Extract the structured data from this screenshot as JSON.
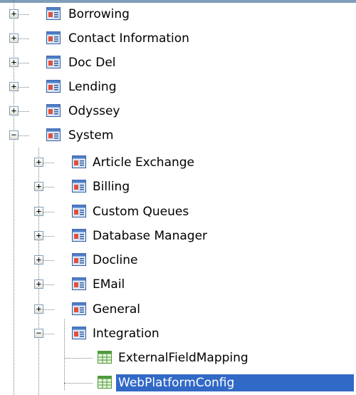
{
  "tree": {
    "nodes": [
      {
        "label": "Borrowing",
        "expander": "+",
        "icon": "report-form-icon"
      },
      {
        "label": "Contact Information",
        "expander": "+",
        "icon": "report-form-icon"
      },
      {
        "label": "Doc Del",
        "expander": "+",
        "icon": "report-form-icon"
      },
      {
        "label": "Lending",
        "expander": "+",
        "icon": "report-form-icon"
      },
      {
        "label": "Odyssey",
        "expander": "+",
        "icon": "report-form-icon"
      },
      {
        "label": "System",
        "expander": "−",
        "icon": "report-form-icon"
      },
      {
        "label": "Article Exchange",
        "expander": "+",
        "icon": "report-form-icon"
      },
      {
        "label": "Billing",
        "expander": "+",
        "icon": "report-form-icon"
      },
      {
        "label": "Custom Queues",
        "expander": "+",
        "icon": "report-form-icon"
      },
      {
        "label": "Database Manager",
        "expander": "+",
        "icon": "report-form-icon"
      },
      {
        "label": "Docline",
        "expander": "+",
        "icon": "report-form-icon"
      },
      {
        "label": "EMail",
        "expander": "+",
        "icon": "report-form-icon"
      },
      {
        "label": "General",
        "expander": "+",
        "icon": "report-form-icon"
      },
      {
        "label": "Integration",
        "expander": "−",
        "icon": "report-form-icon"
      },
      {
        "label": "ExternalFieldMapping",
        "expander": "",
        "icon": "table-grid-icon"
      },
      {
        "label": "WebPlatformConfig",
        "expander": "",
        "icon": "table-grid-icon",
        "selected": true
      }
    ]
  },
  "colors": {
    "selection": "#3169c6",
    "tree_lines": "#7f7f7f",
    "grid_icon": "#4e9a3c"
  }
}
